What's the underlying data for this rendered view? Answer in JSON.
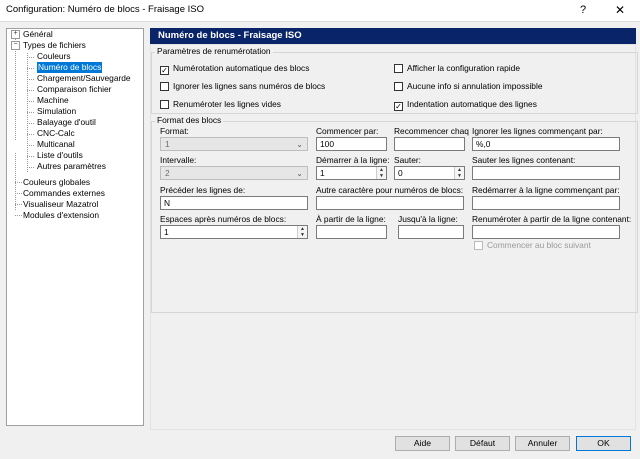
{
  "window": {
    "title": "Configuration: Numéro de blocs - Fraisage ISO",
    "help_icon": "?",
    "close_icon": "✕"
  },
  "tree": {
    "items": [
      {
        "label": "Général",
        "expander": "+"
      },
      {
        "label": "Types de fichiers",
        "expander": "−"
      },
      {
        "label": "Couleurs"
      },
      {
        "label": "Numéro de blocs",
        "selected": true
      },
      {
        "label": "Chargement/Sauvegarde"
      },
      {
        "label": "Comparaison fichier"
      },
      {
        "label": "Machine"
      },
      {
        "label": "Simulation"
      },
      {
        "label": "Balayage d'outil"
      },
      {
        "label": "CNC-Calc"
      },
      {
        "label": "Multicanal"
      },
      {
        "label": "Liste d'outils"
      },
      {
        "label": "Autres paramètres"
      },
      {
        "label": "Couleurs globales"
      },
      {
        "label": "Commandes externes"
      },
      {
        "label": "Visualiseur Mazatrol"
      },
      {
        "label": "Modules d'extension"
      }
    ]
  },
  "header": {
    "title": "Numéro de blocs - Fraisage ISO"
  },
  "renum": {
    "legend": "Paramètres de renumérotation",
    "checks": [
      {
        "label": "Numérotation automatique des blocs",
        "checked": true
      },
      {
        "label": "Ignorer les lignes sans numéros de blocs",
        "checked": false
      },
      {
        "label": "Renuméroter les lignes vides",
        "checked": false
      },
      {
        "label": "Afficher la configuration rapide",
        "checked": false
      },
      {
        "label": "Aucune info si annulation impossible",
        "checked": false
      },
      {
        "label": "Indentation automatique des lignes",
        "checked": true
      }
    ]
  },
  "format": {
    "legend": "Format des blocs",
    "format_label": "Format:",
    "format_value": "1",
    "interval_label": "Intervalle:",
    "interval_value": "2",
    "precede_label": "Précéder les lignes de:",
    "precede_value": "N",
    "spaces_label": "Espaces après numéros de blocs:",
    "spaces_value": "1",
    "start_label": "Commencer par:",
    "start_value": "100",
    "start_line_label": "Démarrer à la ligne:",
    "start_line_value": "1",
    "other_char_label": "Autre caractère pour numéros de blocs:",
    "other_char_value": "",
    "from_line_label": "À partir de la ligne:",
    "from_line_value": "",
    "restart_label": "Recommencer chaq",
    "restart_value": "",
    "skip_label": "Sauter:",
    "skip_value": "0",
    "to_line_label": "Jusqu'à la ligne:",
    "to_line_value": "",
    "ignore_label": "Ignorer les lignes commençant par:",
    "ignore_value": "%,0",
    "skip_lines_label": "Sauter les lignes contenant:",
    "skip_lines_value": "",
    "restart_at_label": "Redémarrer à la ligne commençant par:",
    "restart_at_value": "",
    "renum_from_label": "Renuméroter à partir de la ligne contenant:",
    "renum_from_value": "",
    "next_block_label": "Commencer au bloc suivant"
  },
  "buttons": {
    "help": "Aide",
    "default": "Défaut",
    "cancel": "Annuler",
    "ok": "OK"
  }
}
